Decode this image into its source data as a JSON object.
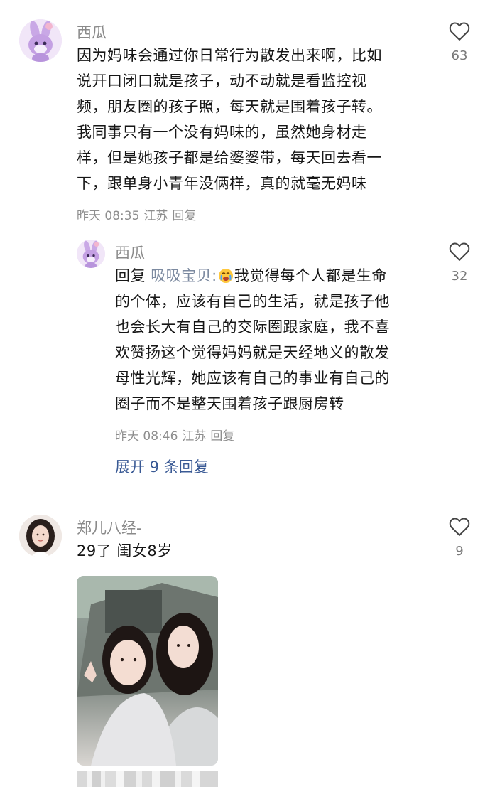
{
  "comments": [
    {
      "username": "西瓜",
      "text_lines": [
        "因为妈味会通过你日常行为散发出来啊，比如",
        "说开口闭口就是孩子，动不动就是看监控视",
        "频，朋友圈的孩子照，每天就是围着孩子转。",
        "我同事只有一个没有妈味的，虽然她身材走",
        "样，但是她孩子都是给婆婆带，每天回去看一",
        "下，跟单身小青年没俩样，真的就毫无妈味"
      ],
      "time": "昨天 08:35",
      "location": "江苏",
      "reply_label": "回复",
      "likes": "63",
      "avatar_icon": "bunny-avatar-icon"
    },
    {
      "username": "西瓜",
      "reply_prefix": "回复",
      "reply_to": "吸吸宝贝:",
      "emoji": "crying-face-emoji",
      "text_lines": [
        "我觉得每个人都是生命",
        "的个体，应该有自己的生活，就是孩子他",
        "也会长大有自己的交际圈跟家庭，我不喜",
        "欢赞扬这个觉得妈妈就是天经地义的散发",
        "母性光辉，她应该有自己的事业有自己的",
        "圈子而不是整天围着孩子跟厨房转"
      ],
      "time": "昨天 08:46",
      "location": "江苏",
      "reply_label": "回复",
      "likes": "32",
      "avatar_icon": "bunny-avatar-icon"
    },
    {
      "username": "郑儿八经-",
      "text": "29了 闺女8岁",
      "likes": "9",
      "photo_icon": "mother-daughter-photo",
      "avatar_icon": "woman-avatar-icon"
    }
  ],
  "expand_replies": "展开 9 条回复",
  "colors": {
    "link": "#3a5a95",
    "muted": "#8e8e8e",
    "text": "#161616"
  }
}
